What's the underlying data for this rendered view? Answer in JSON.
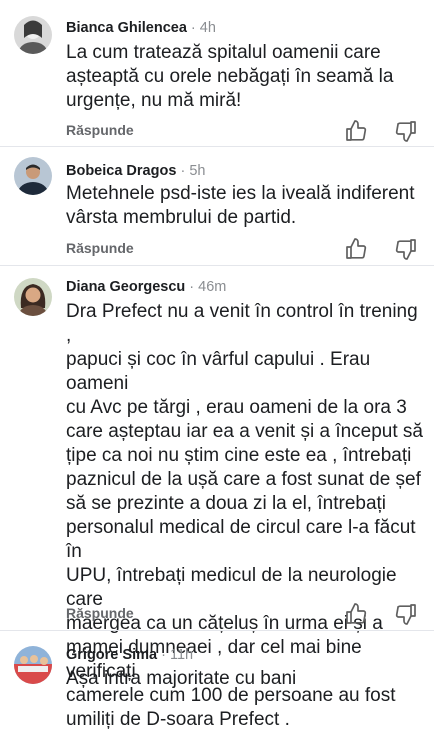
{
  "comments": [
    {
      "author": "Bianca Ghilencea",
      "separator": "·",
      "time": "4h",
      "text": "La cum tratează spitalul oamenii care\nașteaptă cu orele nebăgați în seamă la\nurgențe, nu mă miră!",
      "reply_label": "Răspunde",
      "avatar_icon": "user-photo-avatar"
    },
    {
      "author": "Bobeica Dragos",
      "separator": "·",
      "time": "5h",
      "text": "Metehnele psd-iste ies la iveală indiferent\nvârsta membrului de partid.",
      "reply_label": "Răspunde",
      "avatar_icon": "user-photo-avatar"
    },
    {
      "author": "Diana Georgescu",
      "separator": "·",
      "time": "46m",
      "text": "Dra Prefect nu a venit în control în trening ,\npapuci și coc în vârful capului . Erau oameni\ncu Avc pe tărgi , erau oameni de la ora 3\ncare așteptau iar ea a venit și a început să\nțipe ca noi nu știm cine este ea , întrebați\npaznicul  de la ușă care a fost sunat de șef\nsă se prezinte a doua zi la el, întrebați\npersonalul medical de circul care l-a făcut în\nUPU, întrebați medicul de la neurologie care\nmaergea ca un cățeluș în urma ei și a\nmamei dumneaei , dar cel mai bine verificați\ncamerele cum 100 de persoane au fost\numiliți de D-soara Prefect .",
      "reply_label": "Răspunde",
      "avatar_icon": "user-photo-avatar"
    },
    {
      "author": "Grigore Sima",
      "separator": "·",
      "time": "11h",
      "text": "Așa intra majoritate cu bani",
      "avatar_icon": "user-photo-avatar"
    }
  ],
  "icons": {
    "like": "thumbs-up-icon",
    "dislike": "thumbs-down-icon"
  },
  "colors": {
    "text": "#1c1e21",
    "meta": "#8a8d91",
    "reply": "#65676b",
    "divider": "#e4e6eb"
  }
}
